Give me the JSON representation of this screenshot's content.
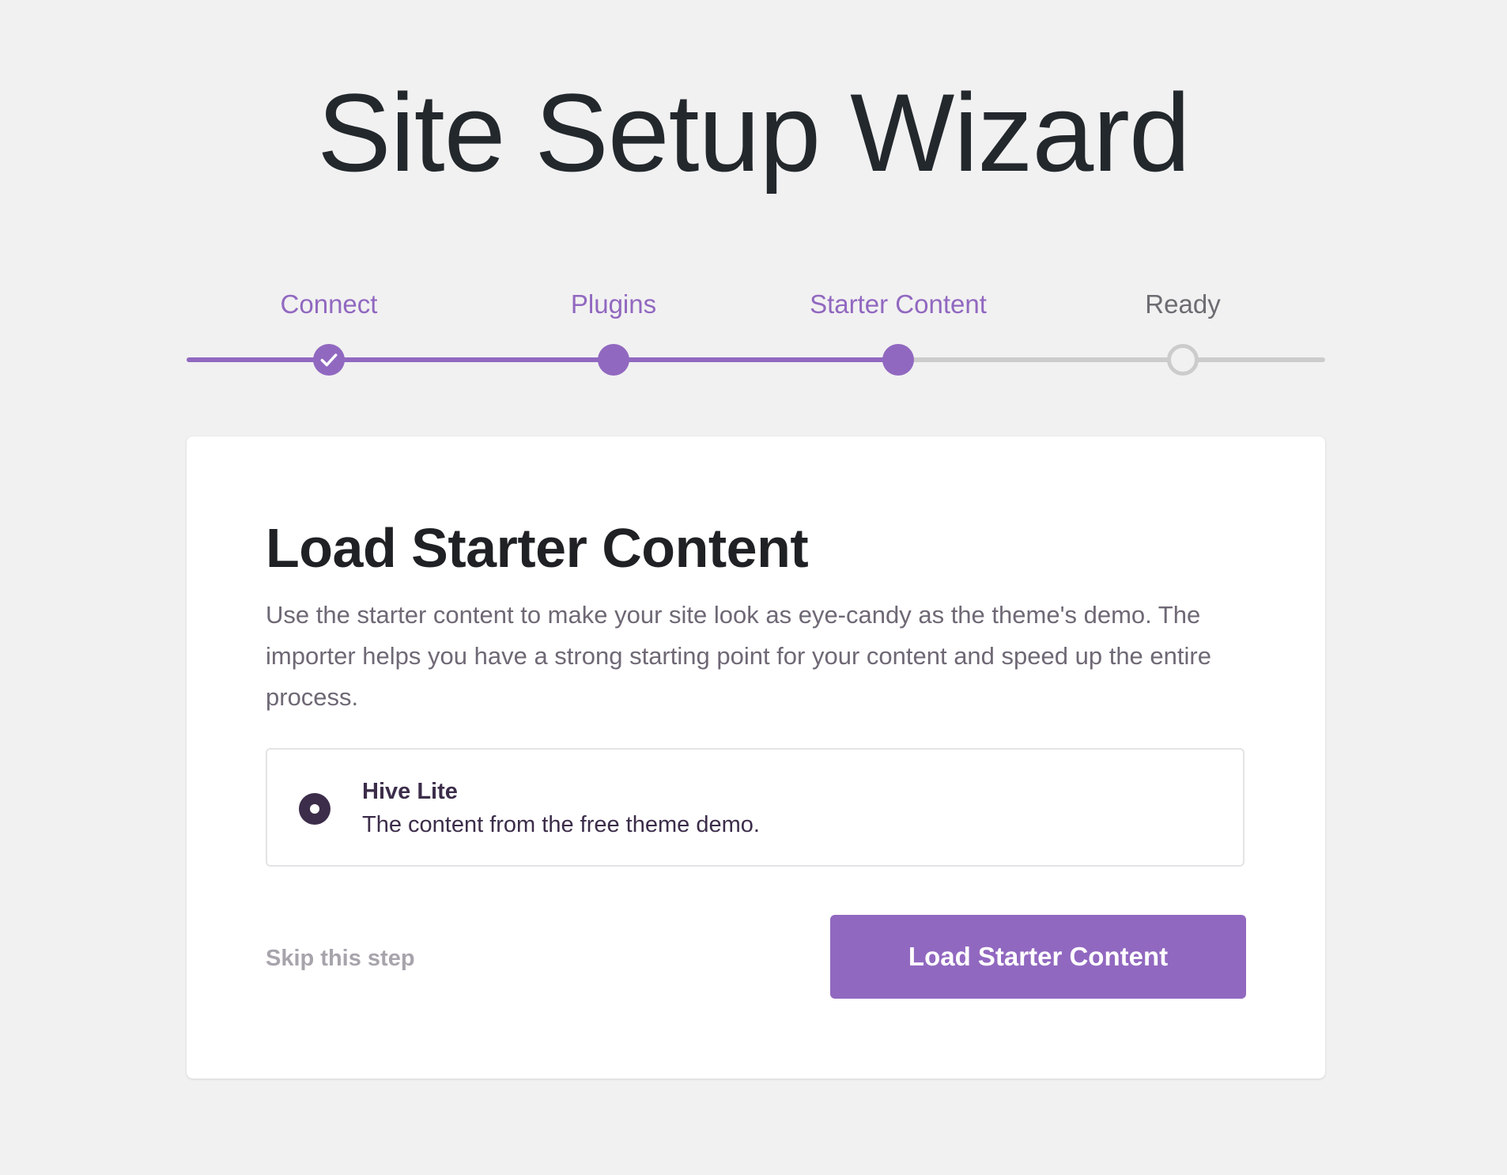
{
  "header": {
    "title": "Site Setup Wizard"
  },
  "stepper": {
    "steps": [
      {
        "label": "Connect",
        "state": "completed"
      },
      {
        "label": "Plugins",
        "state": "completed"
      },
      {
        "label": "Starter Content",
        "state": "current"
      },
      {
        "label": "Ready",
        "state": "pending"
      }
    ],
    "progress_fraction": 0.625,
    "icons": {
      "completed_step": "check-icon"
    }
  },
  "card": {
    "title": "Load Starter Content",
    "description": "Use the starter content to make your site look as eye-candy as the theme's demo. The importer helps you have a strong starting point for your content and speed up the entire process.",
    "option": {
      "name": "Hive Lite",
      "description": "The content from the free theme demo.",
      "selected": true
    },
    "skip_label": "Skip this step",
    "primary_button_label": "Load Starter Content"
  },
  "colors": {
    "accent": "#9168c0",
    "track_inactive": "#cccccc",
    "background": "#f1f1f1",
    "title": "#23282d",
    "radio": "#3c2d4a"
  }
}
